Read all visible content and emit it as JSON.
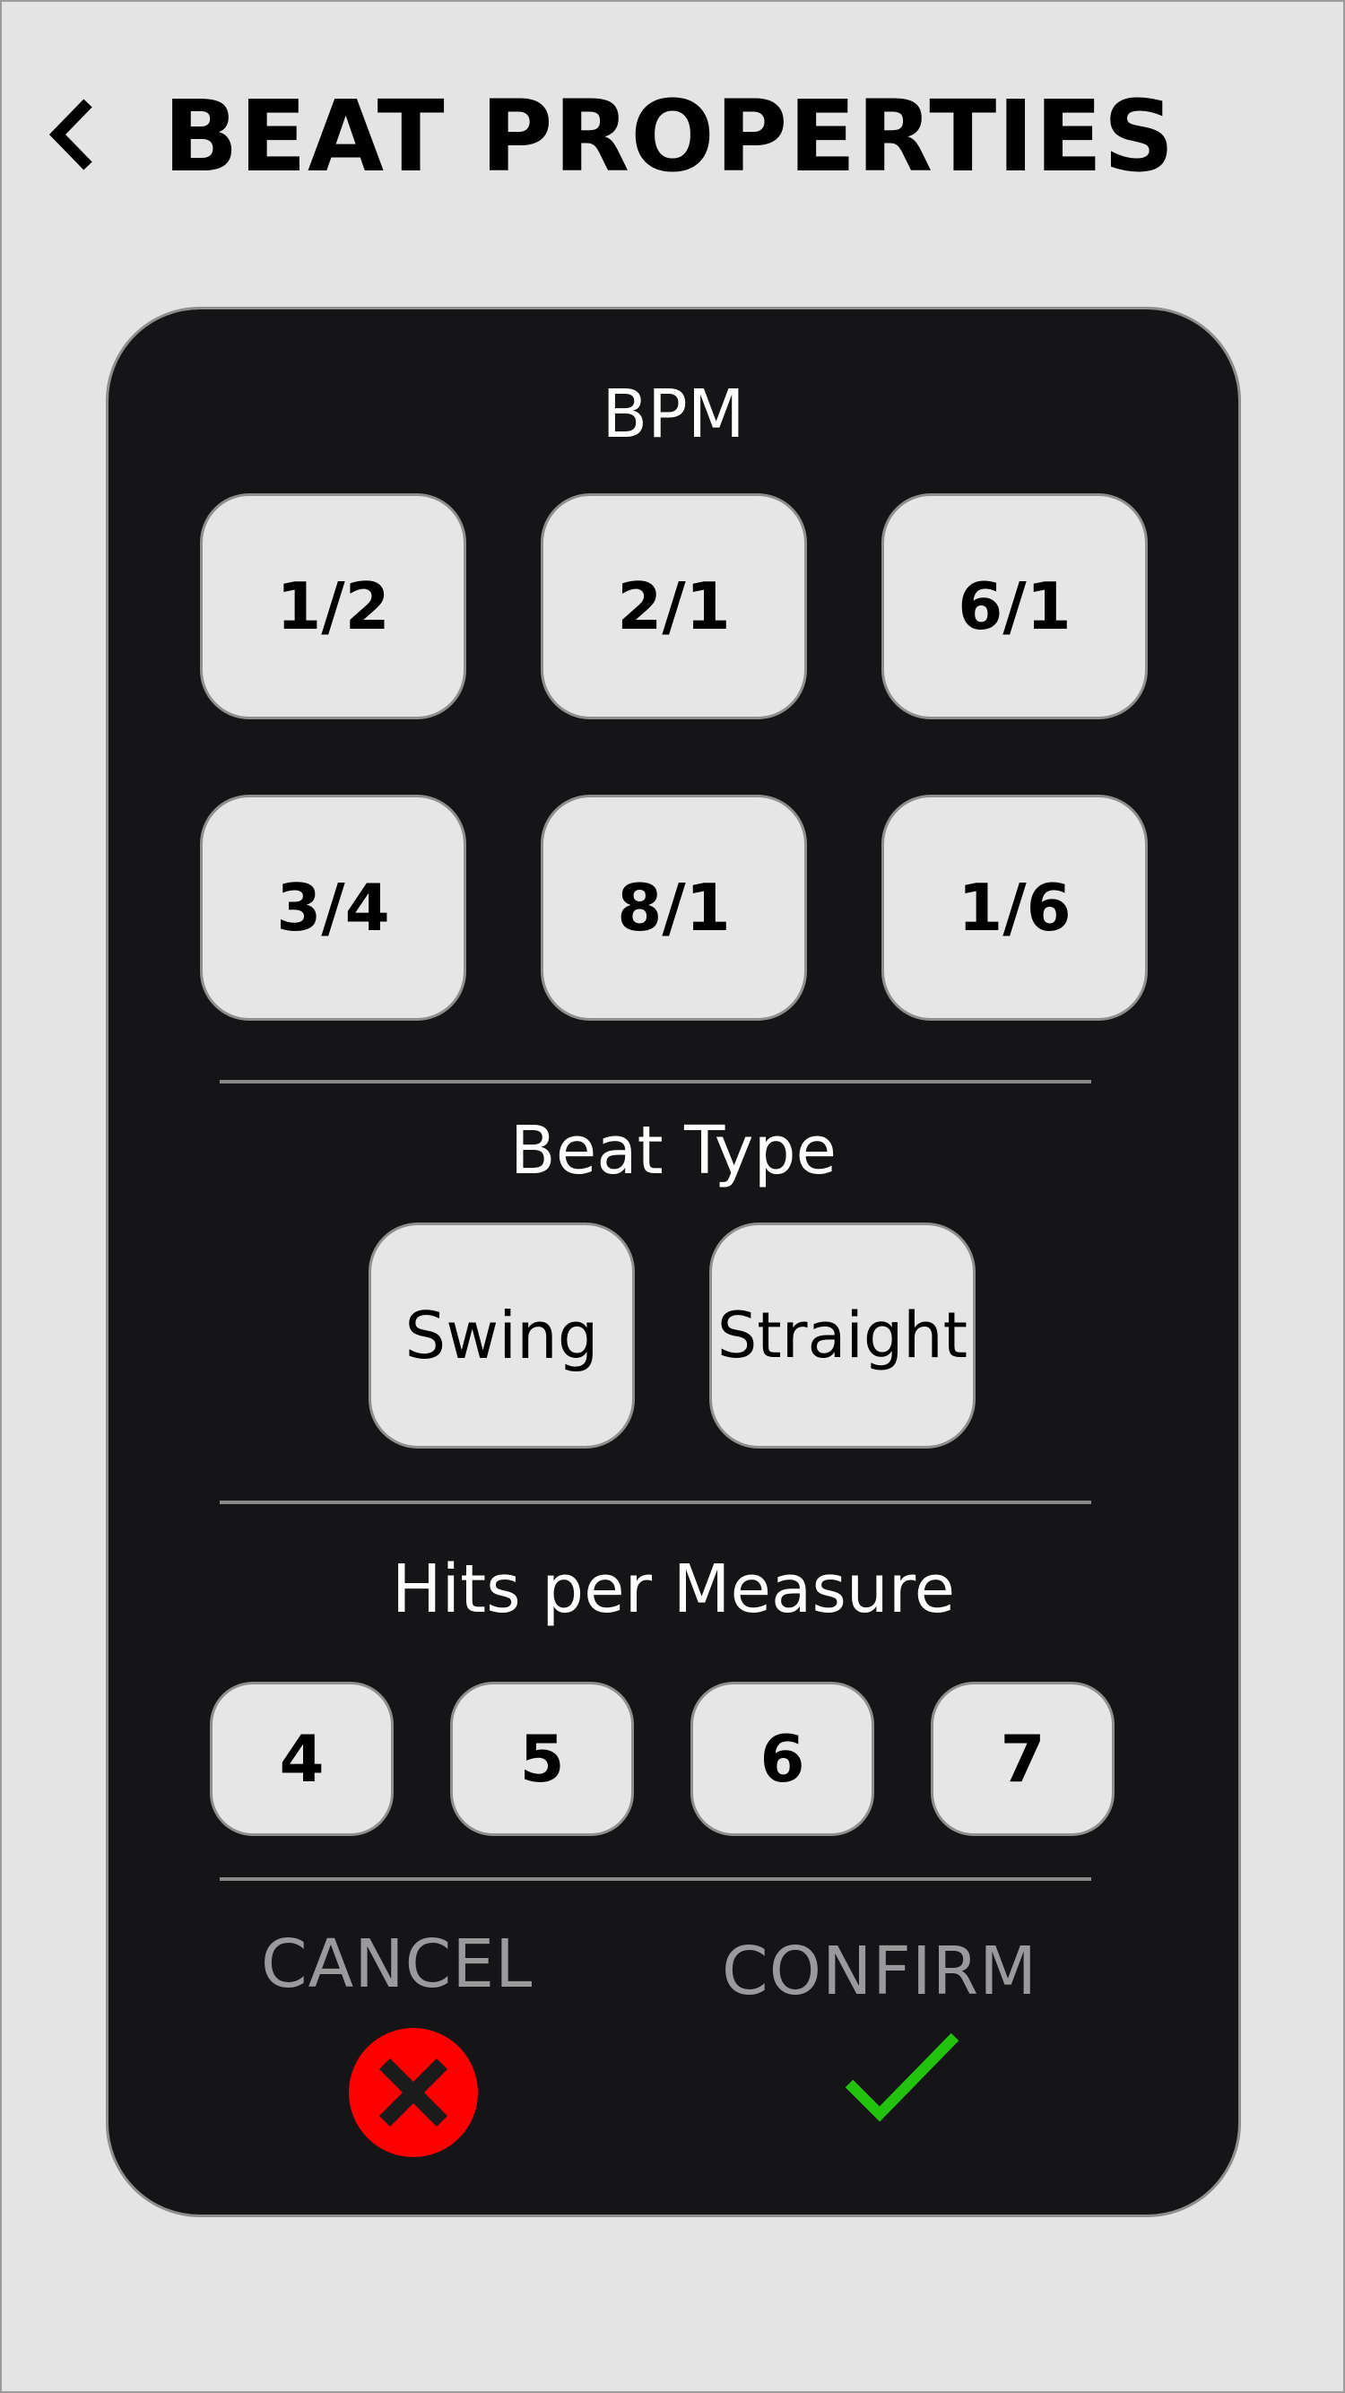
{
  "header": {
    "back_icon": "chevron-left-icon",
    "title": "BEAT PROPERTIES"
  },
  "bpm": {
    "label": "BPM",
    "options": [
      "1/2",
      "2/1",
      "6/1",
      "3/4",
      "8/1",
      "1/6"
    ]
  },
  "beat_type": {
    "label": "Beat Type",
    "options": [
      "Swing",
      "Straight"
    ]
  },
  "hits_per_measure": {
    "label": "Hits per Measure",
    "options": [
      "4",
      "5",
      "6",
      "7"
    ]
  },
  "actions": {
    "cancel_label": "CANCEL",
    "cancel_icon": "close-circle-icon",
    "confirm_label": "CONFIRM",
    "confirm_icon": "checkmark-icon"
  },
  "colors": {
    "background": "#e4e4e5",
    "panel": "#151517",
    "button": "#e6e6e6",
    "cancel": "#ff0000",
    "confirm": "#22c20e",
    "action_text": "#9a9a9c"
  }
}
